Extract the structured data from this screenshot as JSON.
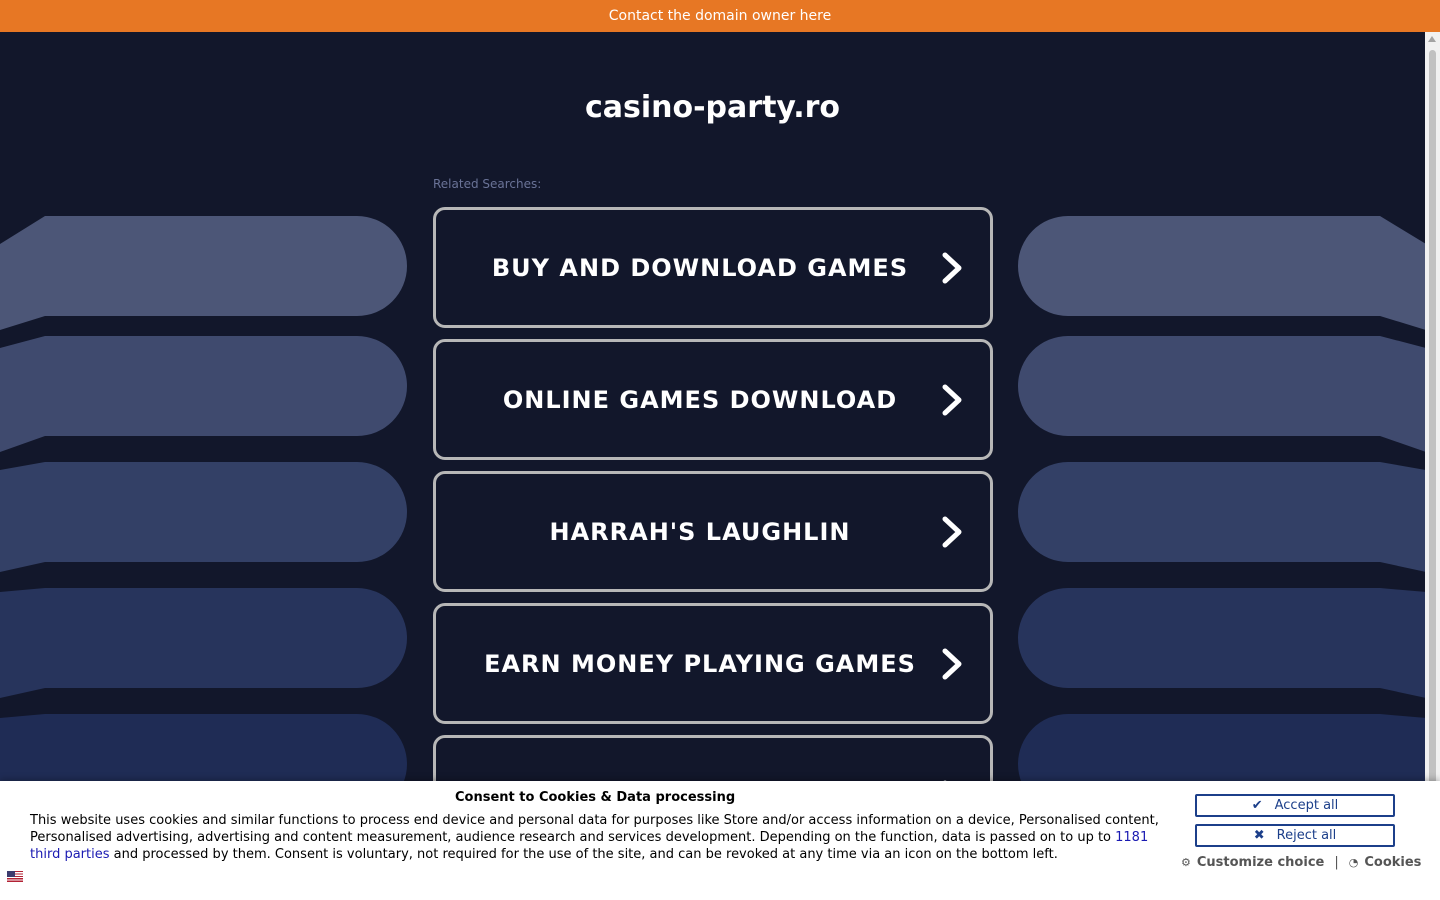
{
  "topbar": {
    "text": "Contact the domain owner here"
  },
  "page": {
    "domain_title": "casino-party.ro",
    "related_label": "Related Searches:",
    "links": [
      {
        "label": "BUY AND DOWNLOAD GAMES"
      },
      {
        "label": "ONLINE GAMES DOWNLOAD"
      },
      {
        "label": "HARRAH'S LAUGHLIN"
      },
      {
        "label": "EARN MONEY PLAYING GAMES"
      },
      {
        "label": ""
      }
    ]
  },
  "consent": {
    "heading": "Consent to Cookies & Data processing",
    "body_part1": "This website uses cookies and similar functions to process end device and personal data for purposes like Store and/or access information on a device, Personalised content, Personalised advertising, advertising and content measurement, audience research and services development. Depending on the function, data is passed on to up to ",
    "third_parties_link": "1181 third parties",
    "body_part2": " and processed by them. Consent is voluntary, not required for the use of the site, and can be revoked at any time via an icon on the bottom left.",
    "accept_label": "Accept all",
    "reject_label": "Reject all",
    "customize_label": "Customize choice",
    "separator": "|",
    "cookies_label": "Cookies"
  },
  "colors": {
    "background": "#12172b",
    "topbar": "#e77724",
    "button_border": "#b7b7b7",
    "consent_button": "#1c3f8a"
  }
}
